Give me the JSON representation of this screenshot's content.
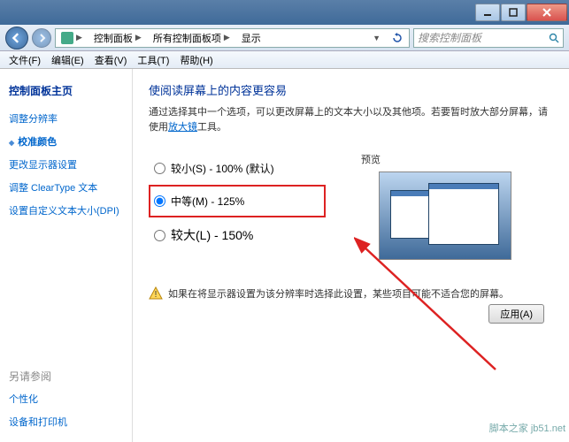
{
  "titlebar": {
    "min": "–",
    "max": "☐",
    "close": "✕"
  },
  "nav": {
    "crumb1": "控制面板",
    "crumb2": "所有控制面板项",
    "crumb3": "显示",
    "search_placeholder": "搜索控制面板"
  },
  "menu": {
    "file": "文件(F)",
    "edit": "编辑(E)",
    "view": "查看(V)",
    "tools": "工具(T)",
    "help": "帮助(H)"
  },
  "sidebar": {
    "title": "控制面板主页",
    "items": {
      "res": "调整分辨率",
      "calib": "校准颜色",
      "mon": "更改显示器设置",
      "ct": "调整 ClearType 文本",
      "dpi": "设置自定义文本大小(DPI)"
    },
    "bottom_hdr": "另请参阅",
    "personal": "个性化",
    "devices": "设备和打印机"
  },
  "main": {
    "heading": "使阅读屏幕上的内容更容易",
    "desc1": "通过选择其中一个选项，可以更改屏幕上的文本大小以及其他项。若要暂时放大部分屏幕，请使用",
    "desc_link": "放大镜",
    "desc2": "工具。",
    "opt_small": "较小(S) - 100% (默认)",
    "opt_med": "中等(M) - 125%",
    "opt_large": "较大(L) - 150%",
    "preview_label": "预览",
    "warn": "如果在将显示器设置为该分辨率时选择此设置，某些项目可能不适合您的屏幕。",
    "apply": "应用(A)"
  },
  "watermark": "脚本之家 jb51.net"
}
